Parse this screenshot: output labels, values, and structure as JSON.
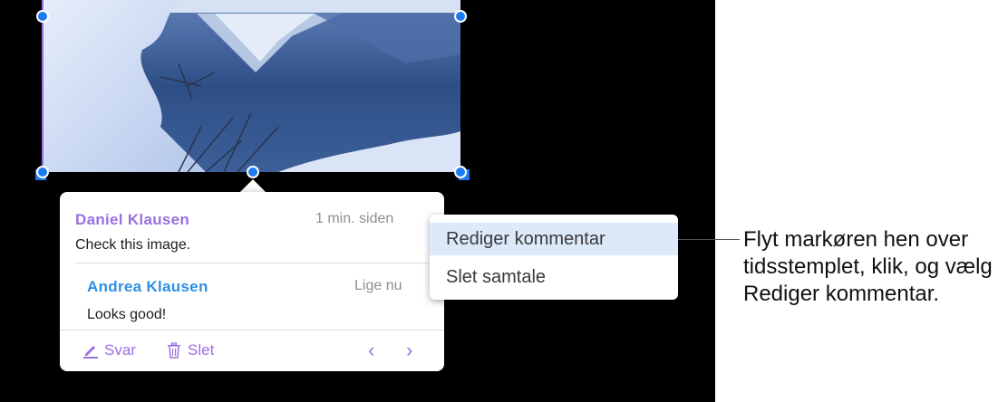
{
  "comment_thread": {
    "comments": [
      {
        "author": "Daniel Klausen",
        "time": "1 min. siden",
        "text": "Check this image.",
        "author_color": "#9b6fe0"
      },
      {
        "author": "Andrea Klausen",
        "time": "Lige nu",
        "text": "Looks good!",
        "author_color": "#2f8fe4"
      }
    ],
    "toolbar": {
      "reply_label": "Svar",
      "delete_label": "Slet",
      "prev_label": "‹",
      "next_label": "›"
    }
  },
  "context_menu": {
    "items": [
      {
        "label": "Rediger kommentar",
        "highlighted": true
      },
      {
        "label": "Slet samtale",
        "highlighted": false
      }
    ]
  },
  "callout": {
    "text": "Flyt markøren hen over tidsstemplet, klik, og vælg Rediger kommentar."
  },
  "colors": {
    "accent": "#9b6fe0",
    "selection": "#1b7cf2",
    "menu_highlight": "#dce9f9"
  }
}
